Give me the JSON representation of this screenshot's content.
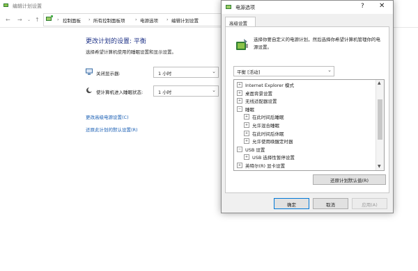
{
  "background_window": {
    "title": "编辑计划设置",
    "breadcrumbs": [
      "控制面板",
      "所有控制面板项",
      "电源选项",
      "编辑计划设置"
    ],
    "page_title": "更改计划的设置: 平衡",
    "page_subtitle": "选择希望计算机使用的睡眠设置和显示设置。",
    "settings": [
      {
        "label": "关闭显示器:",
        "value": "1 小时",
        "icon": "monitor-icon"
      },
      {
        "label": "使计算机进入睡眠状态:",
        "value": "1 小时",
        "icon": "moon-icon"
      }
    ],
    "links": [
      "更改高级电源设置(C)",
      "还原此计划的默认设置(R)"
    ]
  },
  "dialog": {
    "title": "电源选项",
    "help_glyph": "?",
    "close_glyph": "✕",
    "tab": "高级设置",
    "description": "选择你要自定义的电源计划，然后选择你希望计算机管理你的电源设置。",
    "plan_selected": "平衡 [活动]",
    "tree_items": [
      {
        "level": 0,
        "toggle": "+",
        "label": "Internet Explorer 模式"
      },
      {
        "level": 0,
        "toggle": "+",
        "label": "桌面背景设置"
      },
      {
        "level": 0,
        "toggle": "+",
        "label": "无线适配器设置"
      },
      {
        "level": 0,
        "toggle": "−",
        "label": "睡眠"
      },
      {
        "level": 1,
        "toggle": "+",
        "label": "在此时间后睡眠"
      },
      {
        "level": 1,
        "toggle": "+",
        "label": "允许混合睡眠"
      },
      {
        "level": 1,
        "toggle": "+",
        "label": "在此时间后休眠"
      },
      {
        "level": 1,
        "toggle": "+",
        "label": "允许使用唤醒定时器"
      },
      {
        "level": 0,
        "toggle": "−",
        "label": "USB 设置"
      },
      {
        "level": 1,
        "toggle": "+",
        "label": "USB 选择性暂停设置"
      },
      {
        "level": 0,
        "toggle": "+",
        "label": "英特尔(R) 显卡设置"
      }
    ],
    "restore_button": "还原计划默认值(R)",
    "ok": "确定",
    "cancel": "取消",
    "apply": "应用(A)"
  }
}
